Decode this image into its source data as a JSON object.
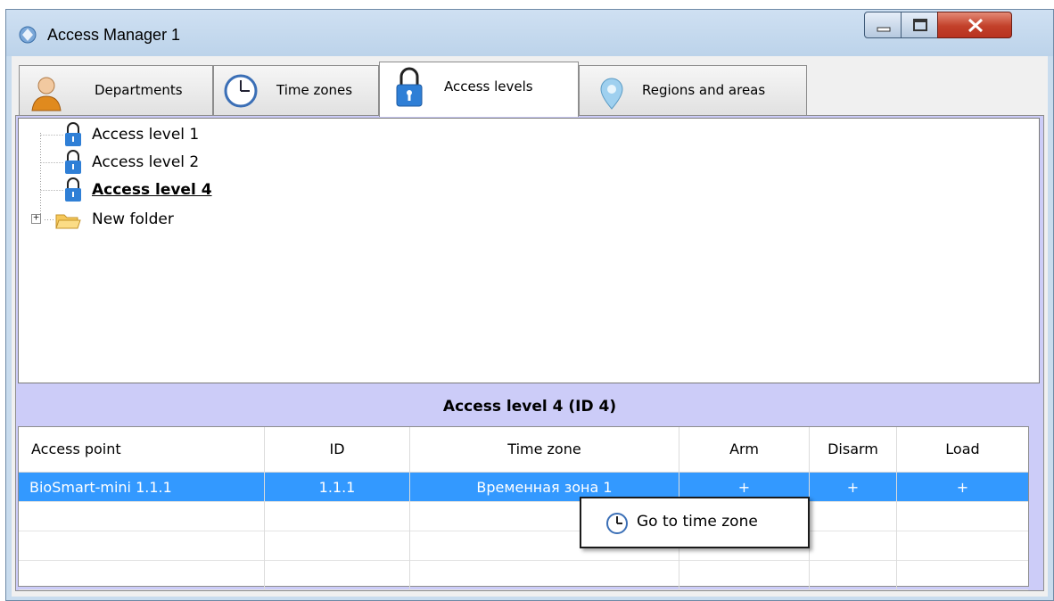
{
  "window": {
    "title": "Access Manager 1"
  },
  "tabs": [
    {
      "label": "Departments",
      "icon": "person-icon"
    },
    {
      "label": "Time zones",
      "icon": "clock-icon"
    },
    {
      "label": "Access levels",
      "icon": "padlock-icon",
      "active": true
    },
    {
      "label": "Regions and areas",
      "icon": "map-pin-icon"
    }
  ],
  "tree": {
    "items": [
      {
        "label": "Access level 1",
        "icon": "padlock-icon"
      },
      {
        "label": "Access level 2",
        "icon": "padlock-icon"
      },
      {
        "label": "Access level 4",
        "icon": "padlock-icon",
        "selected": true
      },
      {
        "label": "New folder",
        "icon": "folder-icon",
        "expander": "+"
      }
    ]
  },
  "details": {
    "title": "Access level 4 (ID 4)",
    "columns": [
      "Access point",
      "ID",
      "Time zone",
      "Arm",
      "Disarm",
      "Load"
    ],
    "rows": [
      {
        "access_point": "BioSmart-mini 1.1.1",
        "id": "1.1.1",
        "time_zone": "Временная зона 1",
        "arm": "+",
        "disarm": "+",
        "load": "+"
      }
    ]
  },
  "context_menu": {
    "item": "Go to time zone",
    "icon": "clock-icon"
  },
  "colors": {
    "selection": "#3399ff",
    "panel": "#ccccf8",
    "close_button": "#c2402a"
  }
}
